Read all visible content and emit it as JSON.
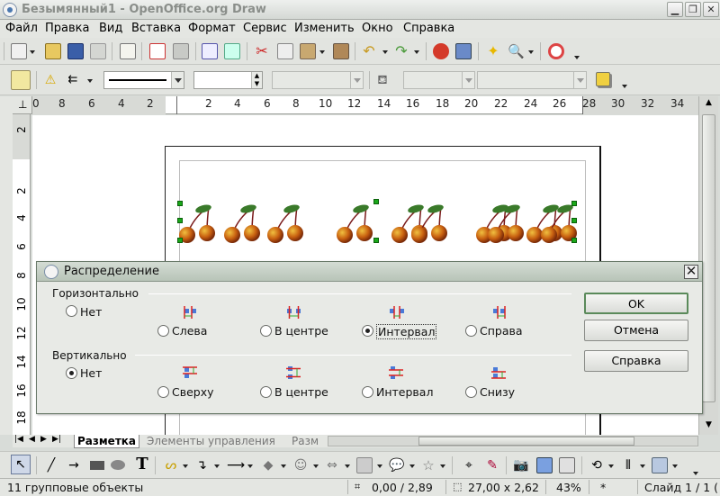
{
  "window": {
    "title": "Безымянный1 - OpenOffice.org Draw"
  },
  "menu": [
    "Файл",
    "Правка",
    "Вид",
    "Вставка",
    "Формат",
    "Сервис",
    "Изменить",
    "Окно",
    "Справка"
  ],
  "format_toolbar": {
    "line_width": "",
    "area_color_value": ""
  },
  "hruler": {
    "ticks": [
      "0",
      "8",
      "6",
      "4",
      "2",
      "2",
      "4",
      "6",
      "8",
      "10",
      "12",
      "14",
      "16",
      "18",
      "20",
      "22",
      "24",
      "26",
      "28",
      "30",
      "32",
      "34"
    ]
  },
  "vruler": {
    "ticks": [
      "2",
      "2",
      "4",
      "6",
      "8",
      "10",
      "12",
      "14",
      "16",
      "18"
    ]
  },
  "dialog": {
    "title": "Распределение",
    "horizontal": {
      "label": "Горизонтально",
      "none": "Нет",
      "options": [
        "Слева",
        "В центре",
        "Интервал",
        "Справа"
      ],
      "selected": "Интервал"
    },
    "vertical": {
      "label": "Вертикально",
      "none": "Нет",
      "options": [
        "Сверху",
        "В центре",
        "Интервал",
        "Снизу"
      ],
      "selected": "Нет"
    },
    "buttons": {
      "ok": "OK",
      "cancel": "Отмена",
      "help": "Справка"
    }
  },
  "tabs": [
    "Разметка",
    "Элементы управления",
    "Разм"
  ],
  "status": {
    "selection": "11 групповые объекты",
    "position": "0,00 / 2,89",
    "size": "27,00 x 2,62",
    "zoom": "43%",
    "modified": "*",
    "slide": "Слайд 1 / 1 ("
  }
}
